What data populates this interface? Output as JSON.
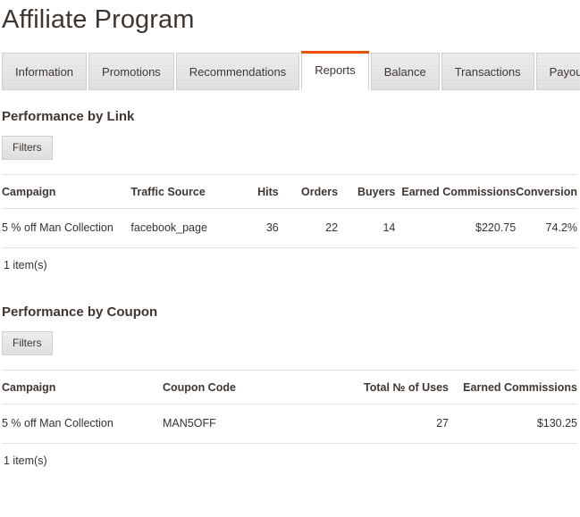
{
  "page": {
    "title": "Affiliate Program"
  },
  "tabs": {
    "items": [
      {
        "label": "Information",
        "active": false
      },
      {
        "label": "Promotions",
        "active": false
      },
      {
        "label": "Recommendations",
        "active": false
      },
      {
        "label": "Reports",
        "active": true
      },
      {
        "label": "Balance",
        "active": false
      },
      {
        "label": "Transactions",
        "active": false
      },
      {
        "label": "Payouts",
        "active": false
      }
    ],
    "accent_color": "#eb5202"
  },
  "performance_by_link": {
    "title": "Performance by Link",
    "filters_label": "Filters",
    "columns": [
      {
        "label": "Campaign",
        "align": "left"
      },
      {
        "label": "Traffic Source",
        "align": "left"
      },
      {
        "label": "Hits",
        "align": "right"
      },
      {
        "label": "Orders",
        "align": "right"
      },
      {
        "label": "Buyers",
        "align": "right"
      },
      {
        "label": "Earned Commissions",
        "align": "right"
      },
      {
        "label": "Conversion",
        "align": "right"
      }
    ],
    "rows": [
      {
        "campaign": "5 % off Man Collection",
        "traffic_source": "facebook_page",
        "hits": "36",
        "orders": "22",
        "buyers": "14",
        "earned_commissions": "$220.75",
        "conversion": "74.2%"
      }
    ],
    "item_count": "1 item(s)"
  },
  "performance_by_coupon": {
    "title": "Performance by Coupon",
    "filters_label": "Filters",
    "columns": [
      {
        "label": "Campaign",
        "align": "left"
      },
      {
        "label": "Coupon Code",
        "align": "left"
      },
      {
        "label": "Total № of Uses",
        "align": "right"
      },
      {
        "label": "Earned Commissions",
        "align": "right"
      }
    ],
    "rows": [
      {
        "campaign": "5 % off Man Collection",
        "coupon_code": "MAN5OFF",
        "total_uses": "27",
        "earned_commissions": "$130.25"
      }
    ],
    "item_count": "1 item(s)"
  }
}
